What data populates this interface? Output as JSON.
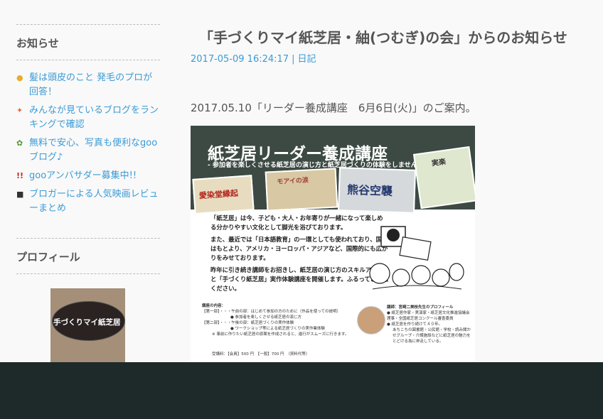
{
  "sidebar": {
    "notice_heading": "お知らせ",
    "notices": [
      {
        "icon": "lightbulb-icon",
        "glyph": "●",
        "color": "#e5b02a",
        "label": "髪は頭皮のこと 発毛のプロが回答！"
      },
      {
        "icon": "ranking-icon",
        "glyph": "✦",
        "color": "#e0713a",
        "label": "みんなが見ているブログをランキングで確認"
      },
      {
        "icon": "sprout-icon",
        "glyph": "✿",
        "color": "#4f9a30",
        "label": "無料で安心、写真も便利なgooブログ♪"
      },
      {
        "icon": "exclamation-icon",
        "glyph": "!!",
        "color": "#d02020",
        "label": "gooアンバサダー募集中!!"
      },
      {
        "icon": "movie-camera-icon",
        "glyph": "■",
        "color": "#333333",
        "label": "ブロガーによる人気映画レビューまとめ"
      }
    ],
    "profile_heading": "プロフィール",
    "profile_image_text": "手づくりマイ紙芝居"
  },
  "post": {
    "title": "「手づくりマイ紙芝居・紬(つむぎ)の会」からのお知らせ",
    "date": "2017-05-09 16:24:17",
    "separator": "|",
    "category": "日記",
    "lead": "2017.05.10「リーダー養成講座　6月6日(火)」のご案内。"
  },
  "flyer": {
    "title": "紙芝居リーダー養成講座",
    "subtitle": "- 参加者を楽しくさせる紙芝居の演じ方と紙芝居づくりの体験をしませんか -",
    "cards": [
      "愛染堂縁起",
      "モアイの涙",
      "熊谷空襲",
      "実楽"
    ],
    "body": [
      "「紙芝居」は今、子ども・大人・お年寄りが一緒になって楽しめる分かりやすい文化として脚光を浴びております。",
      "また、最近では「日本語教育」の一環としても使われており、国内はもとより、アメリカ・ヨーロッパ・アジアなど、国際的にも広がりをみせております。",
      "昨年に引き続き講師をお招きし、紙芝居の演じ方のスキルアップと「手づくり紙芝居」実作体験講座を開催します。ふるってご参加ください。"
    ],
    "details": [
      "講座の内容：",
      "【第一部】・・・午前の部：はじめて参加の方のために（作品を使っての説明）",
      "● 参加者を楽しくさせる紙芝居の演じ方",
      "【第二部】・・・午後の部：紙芝居づくりの実作体験",
      "● ワークショップ等による紙芝居づくりの実作業体験",
      "※ 事前に作りたい紙芝居の原案を作成されると、進行がスムーズに行きます。"
    ],
    "bio": [
      "講師：宮崎二美枝先生のプロフィール",
      "● 紙芝居作家・実演家・紙芝居文化推進協議会理事・全国紙芝居コンクール審査委員",
      "● 紙芝居を作り続けて４０年。",
      "あちこちの図書館・公民館・学校・読み聞かせグループ・介護施設などに紙芝居の魅力をとどける為に奔走している。"
    ],
    "fee": "受講料：【会員】500 円　【一般】700 円　（資料代等）"
  },
  "colors": {
    "link": "#3a9bd6",
    "text": "#555555",
    "background": "#f9f9f9",
    "footer": "#1d2a29"
  }
}
